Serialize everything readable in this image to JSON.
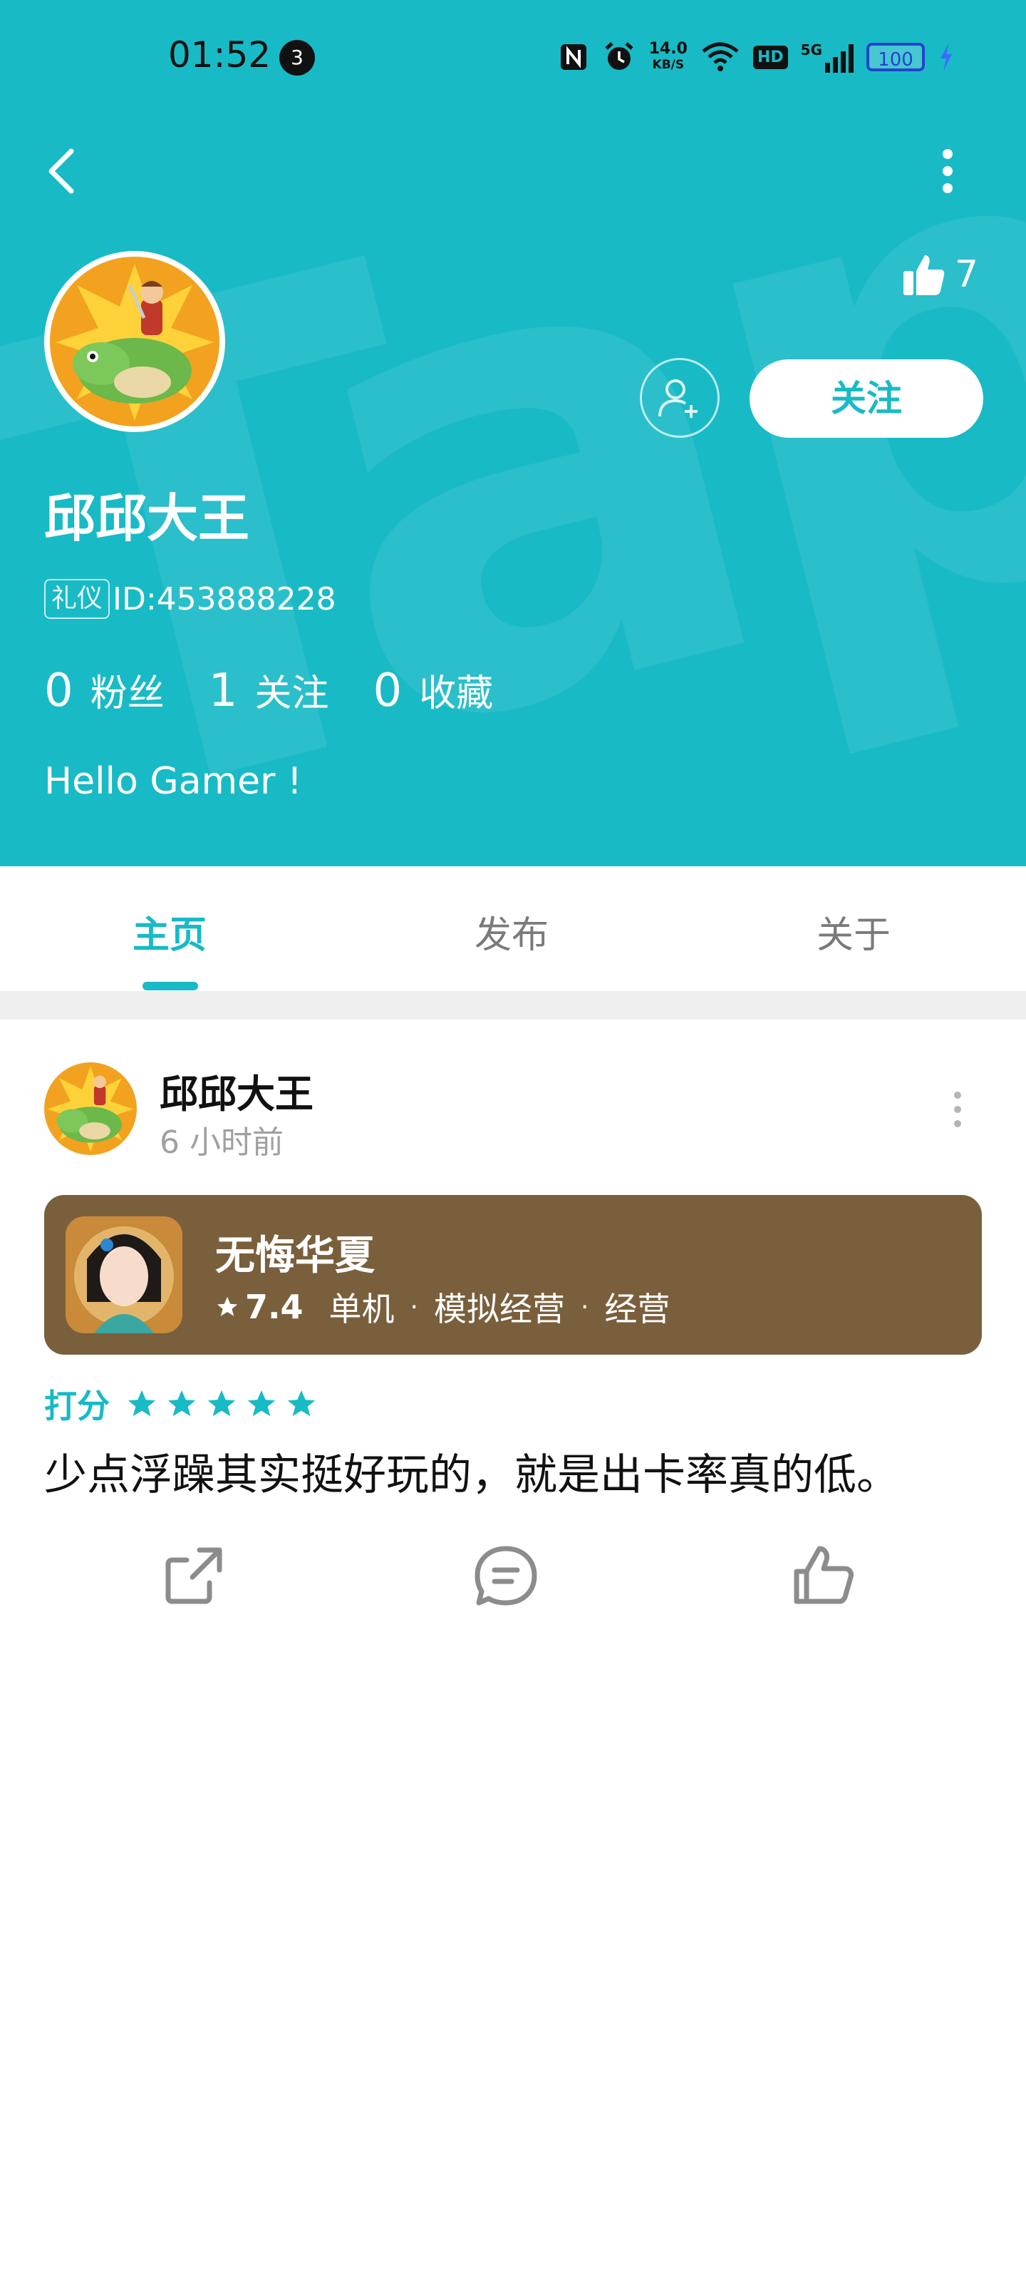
{
  "status_bar": {
    "time": "01:52",
    "notification_count": "3",
    "net_speed_value": "14.0",
    "net_speed_unit": "KB/S",
    "hd_label": "HD",
    "network": "5G",
    "battery": "100"
  },
  "profile": {
    "likes": "7",
    "follow_label": "关注",
    "username": "邱邱大王",
    "tag": "礼仪",
    "id_text": "ID:453888228",
    "stats": [
      {
        "num": "0",
        "label": "粉丝"
      },
      {
        "num": "1",
        "label": "关注"
      },
      {
        "num": "0",
        "label": "收藏"
      }
    ],
    "bio": "Hello Gamer !"
  },
  "tabs": [
    {
      "label": "主页",
      "active": true
    },
    {
      "label": "发布",
      "active": false
    },
    {
      "label": "关于",
      "active": false
    }
  ],
  "post": {
    "author": "邱邱大王",
    "time": "6 小时前",
    "game": {
      "title": "无悔华夏",
      "score": "7.4",
      "tags": [
        "单机",
        "模拟经营",
        "经营"
      ]
    },
    "rating_label": "打分",
    "rating_stars": 5,
    "comment": "少点浮躁其实挺好玩的，就是出卡率真的低。"
  },
  "colors": {
    "accent": "#18BAC6",
    "game_card_bg": "#7A5F3C"
  }
}
